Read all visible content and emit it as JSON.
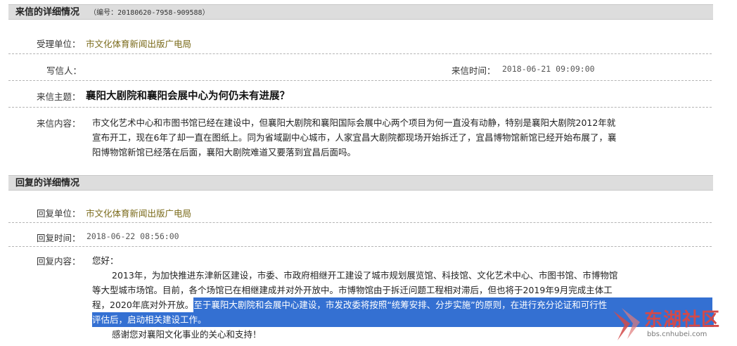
{
  "letter": {
    "section_title": "来信的详细情况",
    "serial": "（编号：20180620-7958-909588）",
    "dept_label": "受理单位：",
    "dept_value": "市文化体育新闻出版广电局",
    "writer_label": "写信人：",
    "time_label": "来信时间：",
    "time_value": "2018-06-21 09:09:00",
    "subject_label": "来信主题：",
    "subject_value": "襄阳大剧院和襄阳会展中心为何仍未有进展？",
    "content_label": "来信内容：",
    "content_lines": [
      "市文化艺术中心和市图书馆已经在建设中，但襄阳大剧院和襄阳国际会展中心两个项目为何一直没有动静，特别是襄阳大剧院2012年就",
      "宣布开工，现在6年了却一直在图纸上。同为省域副中心城市，人家宜昌大剧院都现场开始拆迁了，宜昌博物馆新馆已经开始布展了，襄",
      "阳博物馆新馆已经落在后面，襄阳大剧院难道又要落到宜昌后面吗。"
    ]
  },
  "reply": {
    "section_title": "回复的详细情况",
    "dept_label": "回复单位：",
    "dept_value": "市文化体育新闻出版广电局",
    "time_label": "回复时间：",
    "time_value": "2018-06-22 08:56:00",
    "content_label": "回复内容：",
    "greeting": "您好：",
    "p1_line1": "2013年，为加快推进东津新区建设，市委、市政府相继开工建设了城市规划展览馆、科技馆、文化艺术中心、市图书馆、市博物馆",
    "p1_line2": "等大型城市场馆。目前，各个场馆已在相继建成并对外开放中。市博物馆由于拆迁问题工程相对滞后，但也将于2019年9月完成主体工",
    "p1_line3_plain": "程，2020年底对外开放。",
    "p1_line3_highlight": "至于襄阳大剧院和会展中心建设，市发改委将按照“统筹安排、分步实施”的原则，在进行充分论证和可行性",
    "p1_line4_highlight": "评估后，启动相关建设工作。",
    "closing": "感谢您对襄阳文化事业的关心和支持！"
  },
  "watermark": {
    "brand": "东湖社区",
    "url": "bbs.cnhubei.com"
  },
  "colors": {
    "link": "#7a6a1a",
    "selection": "#3470d2",
    "header_bg": "#dddddd",
    "watermark": "#d24a4a"
  }
}
